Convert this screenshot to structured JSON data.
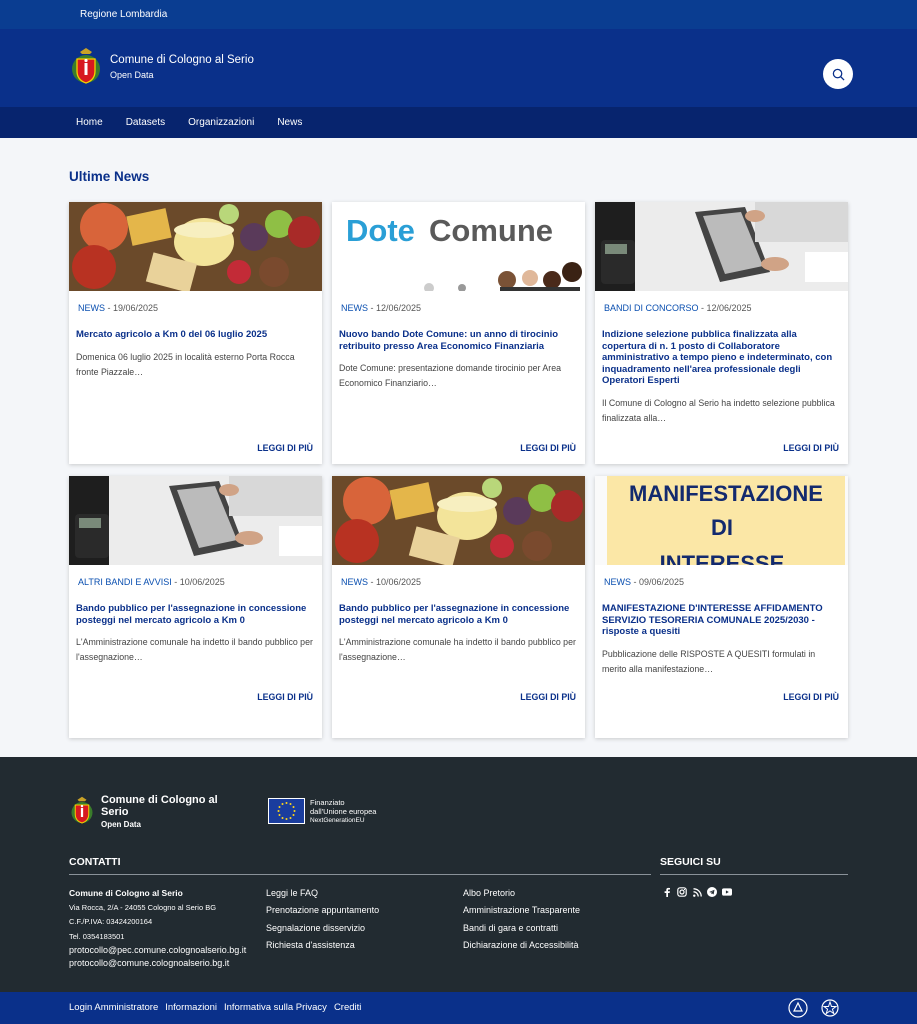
{
  "topbar": {
    "region": "Regione Lombardia"
  },
  "header": {
    "title": "Comune di Cologno al Serio",
    "subtitle": "Open Data"
  },
  "nav": [
    "Home",
    "Datasets",
    "Organizzazioni",
    "News"
  ],
  "main": {
    "heading": "Ultime News",
    "cards": [
      {
        "category": "NEWS",
        "date": "19/06/2025",
        "title": "Mercato agricolo a Km 0 del 06 luglio 2025",
        "desc": "Domenica 06 luglio 2025 in località esterno Porta Rocca fronte Piazzale…",
        "more": "LEGGI DI PIÙ",
        "image": "food"
      },
      {
        "category": "NEWS",
        "date": "12/06/2025",
        "title": "Nuovo bando Dote Comune: un anno di tirocinio retribuito presso Area Economico Finanziaria",
        "desc": "Dote Comune: presentazione domande tirocinio per Area Economico Finanziario…",
        "more": "LEGGI DI PIÙ",
        "image": "dote",
        "image_text_a": "Dote",
        "image_text_b": "Comune"
      },
      {
        "category": "BANDI DI CONCORSO",
        "date": "12/06/2025",
        "title": "Indizione selezione pubblica finalizzata alla copertura di n. 1 posto di Collaboratore amministrativo a tempo pieno e indeterminato, con inquadramento nell'area professionale degli Operatori Esperti",
        "desc": "Il Comune di Cologno al Serio ha indetto selezione pubblica finalizzata alla…",
        "more": "LEGGI DI PIÙ",
        "image": "laptop"
      },
      {
        "category": "ALTRI BANDI E AVVISI",
        "date": "10/06/2025",
        "title": "Bando pubblico per l'assegnazione in concessione posteggi nel mercato agricolo a Km 0",
        "desc": "L'Amministrazione comunale ha indetto il bando pubblico per l'assegnazione…",
        "more": "LEGGI DI PIÙ",
        "image": "laptop"
      },
      {
        "category": "NEWS",
        "date": "10/06/2025",
        "title": "Bando pubblico per l'assegnazione in concessione posteggi nel mercato agricolo a Km 0",
        "desc": "L'Amministrazione comunale ha indetto il bando pubblico per l'assegnazione…",
        "more": "LEGGI DI PIÙ",
        "image": "food"
      },
      {
        "category": "NEWS",
        "date": "09/06/2025",
        "title": "MANIFESTAZIONE D'INTERESSE AFFIDAMENTO SERVIZIO TESORERIA COMUNALE 2025/2030 - risposte a quesiti",
        "desc": "Pubblicazione delle RISPOSTE A QUESITI formulati in merito alla manifestazione…",
        "more": "LEGGI DI PIÙ",
        "image": "manifest",
        "image_text_a": "MANIFESTAZIONE",
        "image_text_b": "DI",
        "image_text_c": "INTERESSE"
      }
    ]
  },
  "footer": {
    "title": "Comune di Cologno al Serio",
    "subtitle": "Open Data",
    "eu_line1": "Finanziato",
    "eu_line2": "dall'Unione europea",
    "eu_line3": "NextGenerationEU",
    "contacts_heading": "CONTATTI",
    "social_heading": "SEGUICI SU",
    "org": "Comune di Cologno al Serio",
    "address": "Via Rocca, 2/A - 24055 Cologno al Serio BG",
    "vat": "C.F./P.IVA: 03424200164",
    "phone": "Tel. 0354183501",
    "pec": "protocollo@pec.comune.colognoalserio.bg.it",
    "email": "protocollo@comune.colognoalserio.bg.it",
    "links_col1": [
      "Leggi le FAQ",
      "Prenotazione appuntamento",
      "Segnalazione disservizio",
      "Richiesta d'assistenza"
    ],
    "links_col2": [
      "Albo Pretorio",
      "Amministrazione Trasparente",
      "Bandi di gara e contratti",
      "Dichiarazione di Accessibilità"
    ],
    "social_icons": [
      "facebook-icon",
      "instagram-icon",
      "rss-icon",
      "telegram-icon",
      "youtube-icon"
    ]
  },
  "bottombar": {
    "links": [
      "Login Amministratore",
      "Informazioni",
      "Informativa sulla Privacy",
      "Crediti"
    ]
  },
  "colors": {
    "primary": "#0a308a",
    "topbar": "#0a3d91",
    "nav": "#07246e",
    "footer": "#222b31",
    "category": "#0a4fb0"
  }
}
